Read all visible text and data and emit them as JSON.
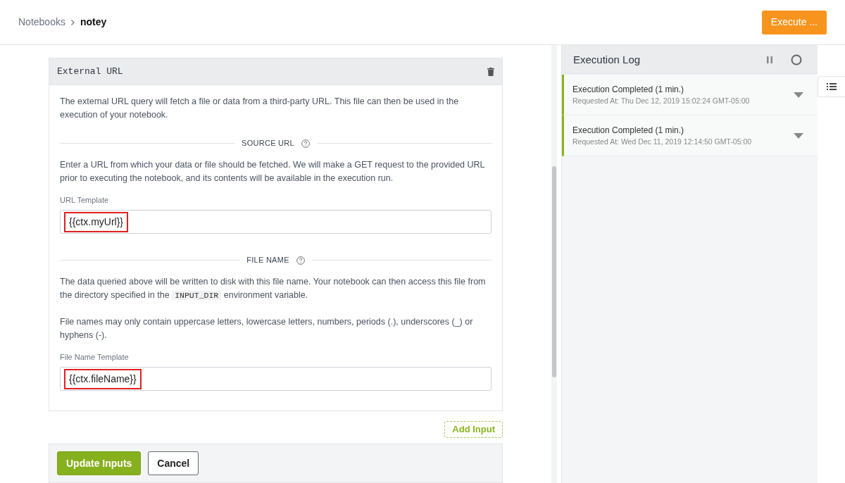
{
  "breadcrumb": [
    {
      "label": "Notebooks",
      "current": false
    },
    {
      "label": "notey",
      "current": true
    }
  ],
  "execute_button": "Execute ...",
  "card": {
    "title": "External URL",
    "intro": "The external URL query will fetch a file or data from a third-party URL. This file can then be used in the execution of your notebook.",
    "sections": [
      {
        "heading": "SOURCE URL",
        "paragraphs": [
          "Enter a URL from which your data or file should be fetched. We will make a GET request to the provided URL prior to executing the notebook, and its contents will be available in the execution run."
        ],
        "field_label": "URL Template",
        "value": "{{ctx.myUrl}}",
        "highlighted": true
      },
      {
        "heading": "FILE NAME",
        "paragraphs": [
          [
            {
              "kind": "text",
              "text": "The data queried above will be written to disk with this file name. Your notebook can then access this file from the directory specified in the "
            },
            {
              "kind": "code",
              "text": "INPUT_DIR"
            },
            {
              "kind": "text",
              "text": " environment variable."
            }
          ],
          "File names may only contain uppercase letters, lowercase letters, numbers, periods (.), underscores (_) or hyphens (-)."
        ],
        "field_label": "File Name Template",
        "value": "{{ctx.fileName}}",
        "highlighted": true
      }
    ]
  },
  "add_input_button": "Add Input",
  "footer_buttons": [
    {
      "label": "Update Inputs",
      "kind": "primary"
    },
    {
      "label": "Cancel",
      "kind": "secondary"
    }
  ],
  "execution_log": {
    "title": "Execution Log",
    "entries": [
      {
        "status": "Execution Completed (1 min.)",
        "requested": "Requested At: Thu Dec 12, 2019 15:02:24 GMT-05:00",
        "color": "#8ab31f"
      },
      {
        "status": "Execution Completed (1 min.)",
        "requested": "Requested At: Wed Dec 11, 2019 12:14:50 GMT-05:00",
        "color": "#8ab31f"
      }
    ]
  }
}
